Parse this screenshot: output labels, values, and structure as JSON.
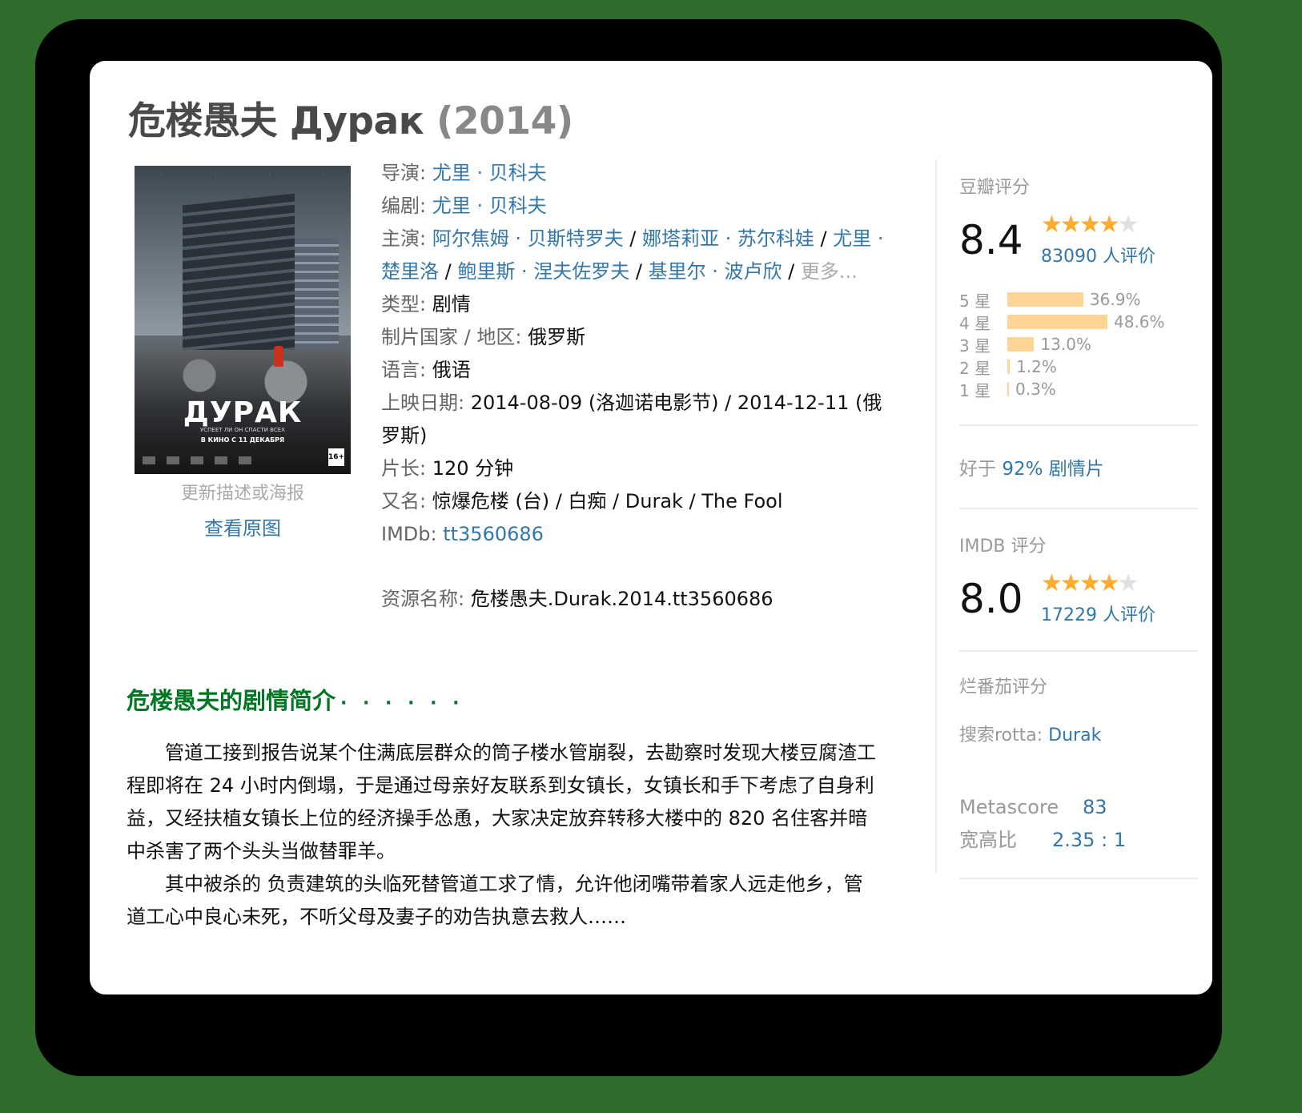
{
  "title": {
    "main": "危楼愚夫 Дурак",
    "year": "(2014)"
  },
  "poster": {
    "title": "ДУРАК",
    "tagline": "УСПЕЕТ ЛИ ОН СПАСТИ ВСЕХ",
    "release": "В КИНО С 11 ДЕКАБРЯ",
    "age": "16+",
    "update_link": "更新描述或海报",
    "original_link": "查看原图"
  },
  "info": {
    "director_label": "导演",
    "director": "尤里 · 贝科夫",
    "writer_label": "编剧",
    "writer": "尤里 · 贝科夫",
    "cast_label": "主演",
    "cast": [
      "阿尔焦姆 · 贝斯特罗夫",
      "娜塔莉亚 · 苏尔科娃",
      "尤里 · 楚里洛",
      "鲍里斯 · 涅夫佐罗夫",
      "基里尔 · 波卢欣"
    ],
    "cast_more": "更多...",
    "genre_label": "类型",
    "genre": "剧情",
    "country_label": "制片国家 / 地区",
    "country": "俄罗斯",
    "language_label": "语言",
    "language": "俄语",
    "release_label": "上映日期",
    "release": "2014-08-09 (洛迦诺电影节) / 2014-12-11 (俄罗斯)",
    "runtime_label": "片长",
    "runtime": "120 分钟",
    "aka_label": "又名",
    "aka": "惊爆危楼 (台) / 白痴 / Durak / The Fool",
    "imdb_label": "IMDb",
    "imdb": "tt3560686",
    "resource_label": "资源名称",
    "resource": "危楼愚夫.Durak.2014.tt3560686"
  },
  "synopsis": {
    "heading": "危楼愚夫的剧情简介",
    "dots": "· · · · · ·",
    "p1": "管道工接到报告说某个住满底层群众的筒子楼水管崩裂，去勘察时发现大楼豆腐渣工程即将在 24 小时内倒塌，于是通过母亲好友联系到女镇长，女镇长和手下考虑了自身利益，又经扶植女镇长上位的经济操手怂恿，大家决定放弃转移大楼中的 820 名住客并暗中杀害了两个头头当做替罪羊。",
    "p2": "其中被杀的 负责建筑的头临死替管道工求了情，允许他闭嘴带着家人远走他乡，管道工心中良心未死，不听父母及妻子的劝告执意去救人……"
  },
  "douban": {
    "heading": "豆瓣评分",
    "score": "8.4",
    "stars": 4,
    "count": "83090 人评价",
    "distribution": [
      {
        "label": "5 星",
        "pct": "36.9%",
        "value": 36.9
      },
      {
        "label": "4 星",
        "pct": "48.6%",
        "value": 48.6
      },
      {
        "label": "3 星",
        "pct": "13.0%",
        "value": 13.0
      },
      {
        "label": "2 星",
        "pct": "1.2%",
        "value": 1.2
      },
      {
        "label": "1 星",
        "pct": "0.3%",
        "value": 0.3
      }
    ],
    "better_prefix": "好于",
    "better_link": "92% 剧情片"
  },
  "imdb": {
    "heading": "IMDB 评分",
    "score": "8.0",
    "stars": 4,
    "count": "17229 人评价"
  },
  "rotten": {
    "heading": "烂番茄评分",
    "search_label": "搜索rotta:",
    "search_link": "Durak"
  },
  "meta": {
    "metascore_label": "Metascore",
    "metascore": "83",
    "aspect_label": "宽高比",
    "aspect": "2.35 : 1"
  },
  "colors": {
    "link": "#3377aa",
    "green": "#007722",
    "star": "#ffac2d",
    "bar": "#ffd596",
    "background": "#2f6b2a"
  }
}
